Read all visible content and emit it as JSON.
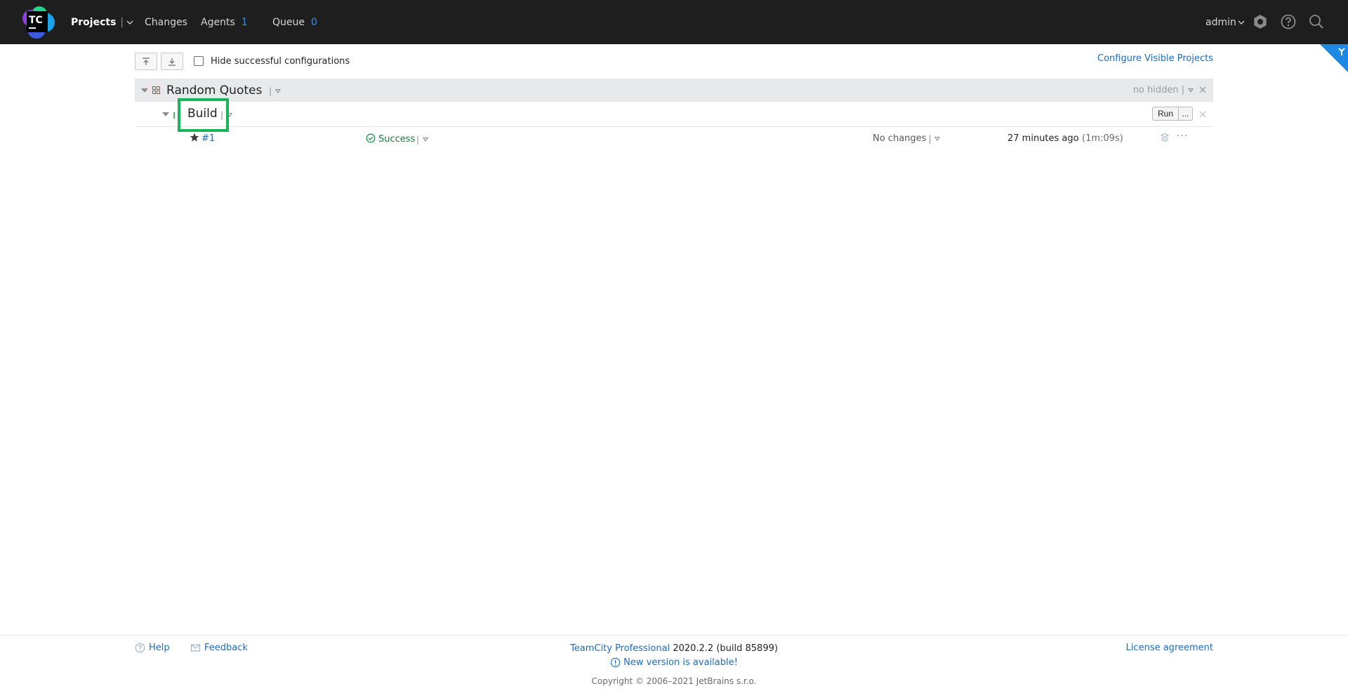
{
  "header": {
    "logo_text": "TC",
    "nav": {
      "projects": "Projects",
      "changes": "Changes",
      "agents": "Agents",
      "agents_count": "1",
      "queue": "Queue",
      "queue_count": "0"
    },
    "user": "admin",
    "icons": [
      "settings-icon",
      "help-icon",
      "search-icon"
    ]
  },
  "toolbar": {
    "collapse_all_icon": "collapse-all-icon",
    "expand_all_icon": "expand-all-icon",
    "hide_successful_label": "Hide successful configurations",
    "hide_successful_checked": false,
    "configure_link": "Configure Visible Projects"
  },
  "project": {
    "name": "Random Quotes",
    "menu_separator": "|",
    "hidden_label": "no hidden",
    "hidden_separator": "|"
  },
  "build_config": {
    "name": "Build",
    "menu_separator": "|",
    "run_label": "Run",
    "more_label": "..."
  },
  "build": {
    "number": "#1",
    "status": "Success",
    "status_separator": "|",
    "changes": "No changes",
    "changes_separator": "|",
    "time": "27 minutes ago",
    "duration": "(1m:09s)",
    "more_label": "···"
  },
  "footer": {
    "help": "Help",
    "feedback": "Feedback",
    "product_link": "TeamCity Professional",
    "version": "2020.2.2 (build 85899)",
    "new_version": "New version is available!",
    "copyright": "Copyright © 2006–2021 JetBrains s.r.o.",
    "license": "License agreement"
  },
  "colors": {
    "header_bg": "#1e1e1e",
    "link": "#1f6bb5",
    "success": "#1a7a3e",
    "highlight": "#1ab45a",
    "project_row_bg": "#e8e9ea",
    "corner_badge": "#1e88e5"
  }
}
